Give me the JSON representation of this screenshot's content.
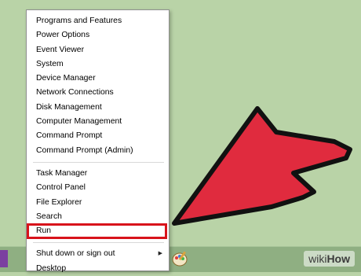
{
  "menu": {
    "groups": [
      {
        "items": [
          {
            "label": "Programs and Features"
          },
          {
            "label": "Power Options"
          },
          {
            "label": "Event Viewer"
          },
          {
            "label": "System"
          },
          {
            "label": "Device Manager"
          },
          {
            "label": "Network Connections"
          },
          {
            "label": "Disk Management"
          },
          {
            "label": "Computer Management"
          },
          {
            "label": "Command Prompt"
          },
          {
            "label": "Command Prompt (Admin)"
          }
        ]
      },
      {
        "items": [
          {
            "label": "Task Manager"
          },
          {
            "label": "Control Panel"
          },
          {
            "label": "File Explorer"
          },
          {
            "label": "Search"
          },
          {
            "label": "Run"
          }
        ]
      },
      {
        "items": [
          {
            "label": "Shut down or sign out"
          },
          {
            "label": "Desktop"
          }
        ]
      }
    ],
    "highlighted_item": "Run",
    "highlight_color": "#d8131b"
  },
  "overlay": {
    "arrow_color": "#e02b3e",
    "arrow_outline_color": "#111111"
  },
  "watermark": {
    "prefix": "wiki",
    "suffix": "How"
  },
  "colors": {
    "desktop_background": "#b9d3a7",
    "taskbar": "#8faf82"
  },
  "icons": {
    "submenu": "chevron-right-icon",
    "taskbar_app": "paint-icon"
  }
}
